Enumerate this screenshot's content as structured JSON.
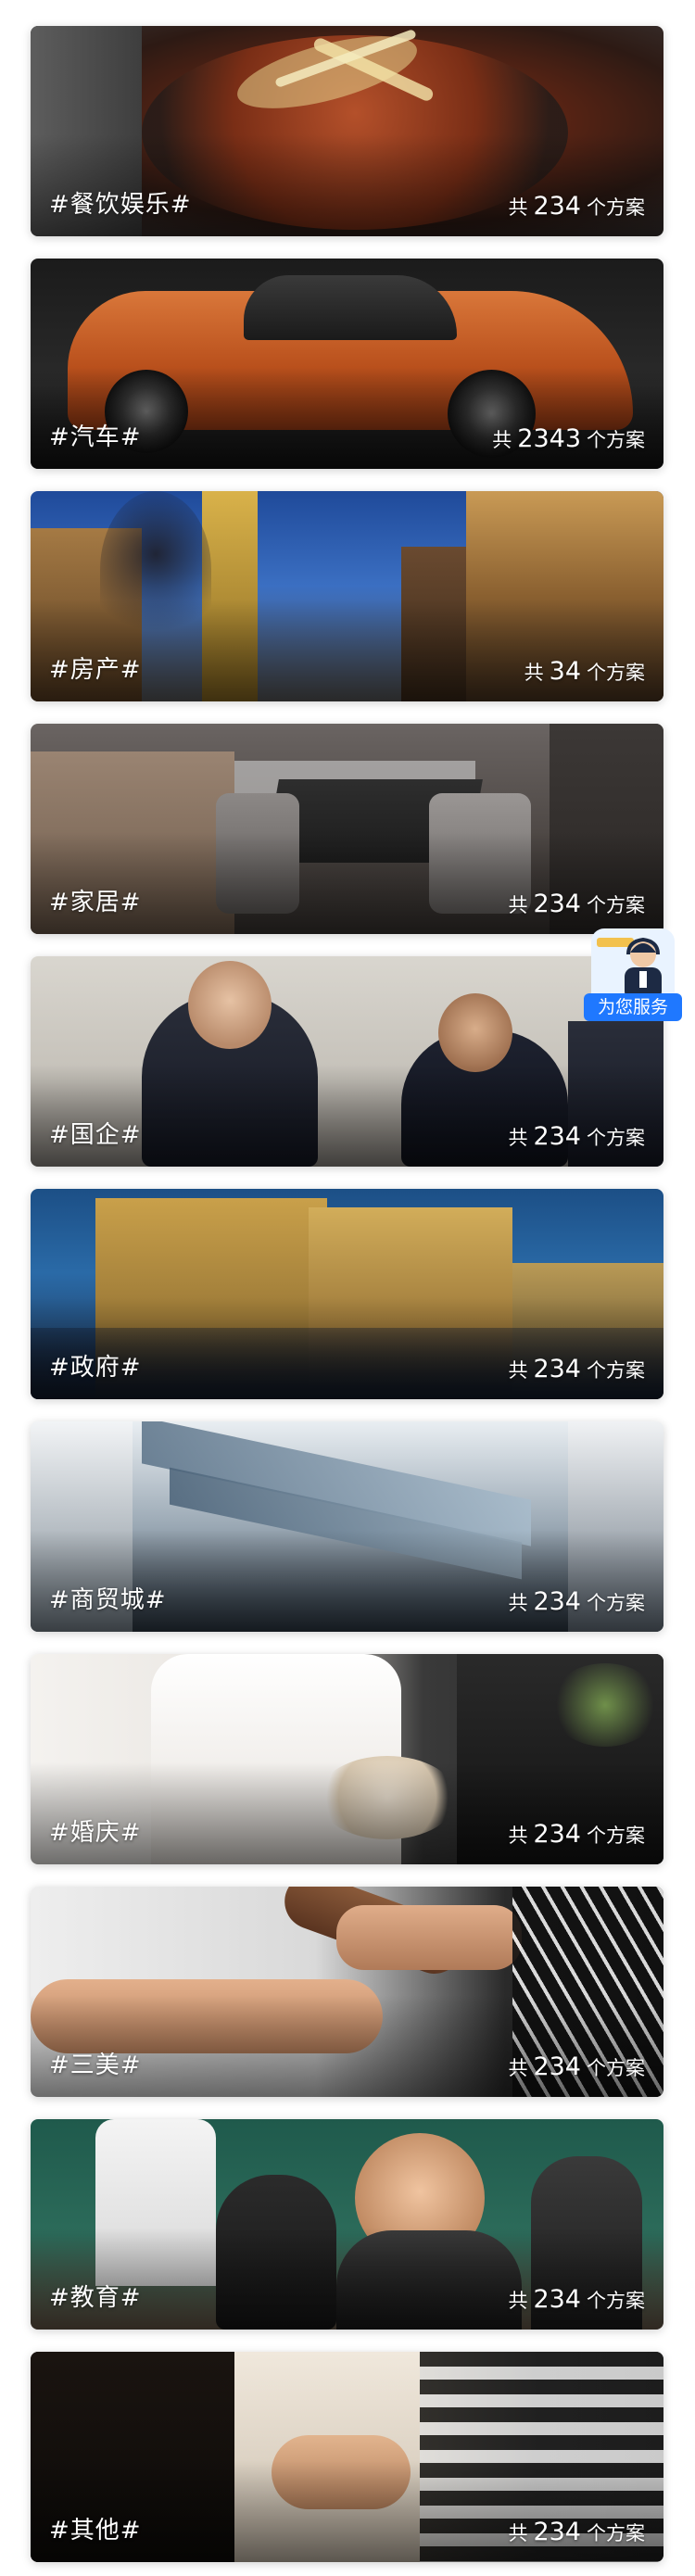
{
  "count_prefix": "共",
  "count_suffix": "个方案",
  "categories": [
    {
      "title": "#餐饮娱乐#",
      "count": "234"
    },
    {
      "title": "#汽车#",
      "count": "2343"
    },
    {
      "title": "#房产#",
      "count": "34"
    },
    {
      "title": "#家居#",
      "count": "234"
    },
    {
      "title": "#国企#",
      "count": "234"
    },
    {
      "title": "#政府#",
      "count": "234"
    },
    {
      "title": "#商贸城#",
      "count": "234"
    },
    {
      "title": "#婚庆#",
      "count": "234"
    },
    {
      "title": "#三美#",
      "count": "234"
    },
    {
      "title": "#教育#",
      "count": "234"
    },
    {
      "title": "#其他#",
      "count": "234"
    }
  ],
  "service": {
    "label": "为您服务",
    "icon": "customer-service-agent-icon"
  },
  "colors": {
    "service_blue": "#1f78ff",
    "text_white": "#ffffff"
  }
}
